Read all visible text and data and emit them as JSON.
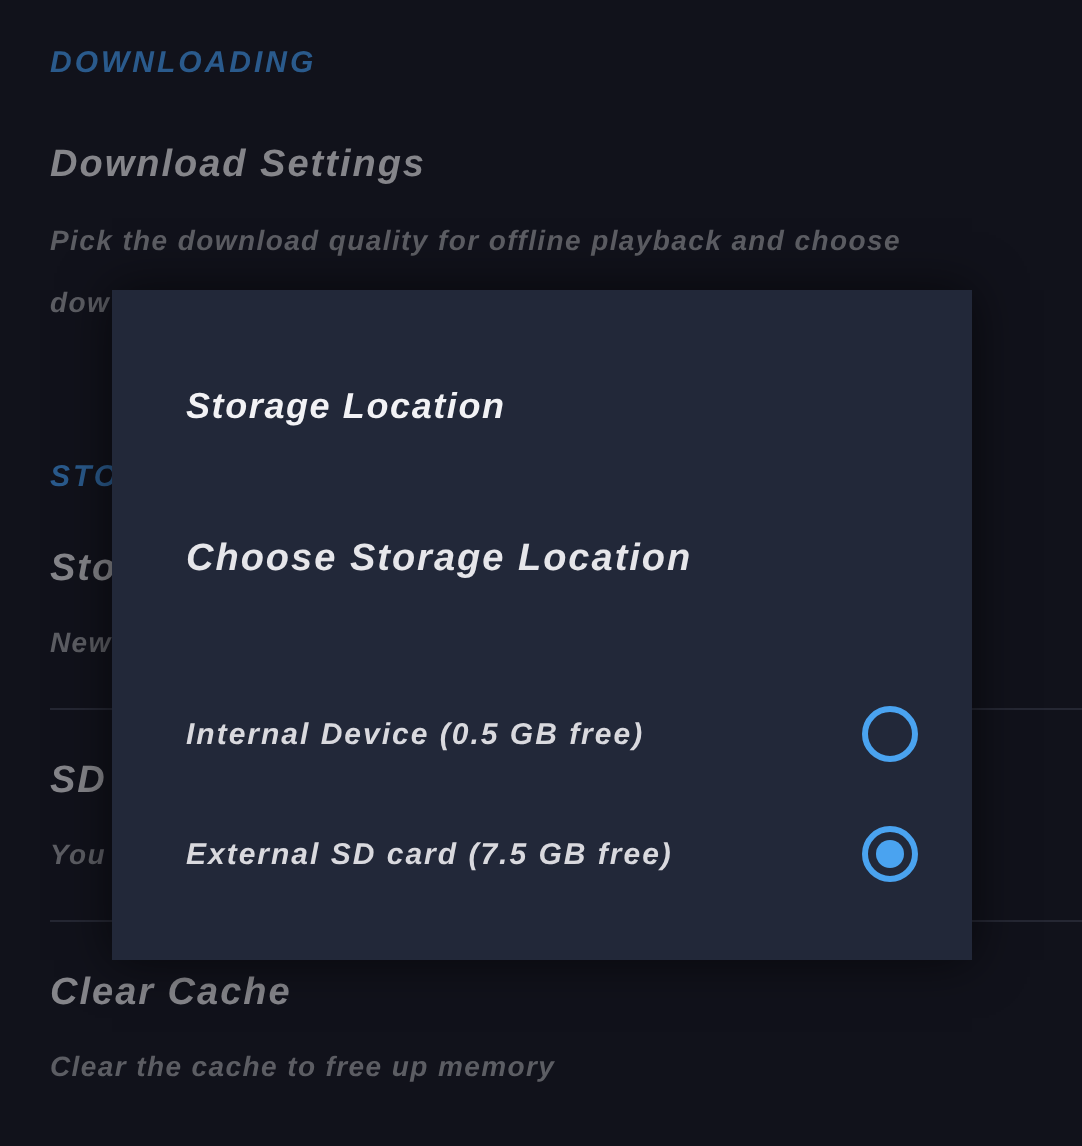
{
  "sections": [
    {
      "header": "DOWNLOADING",
      "items": [
        {
          "title": "Download Settings",
          "description": [
            "Pick the download quality for offline playback and choose",
            "dow"
          ]
        }
      ]
    },
    {
      "header": "STO",
      "items": [
        {
          "title": "Sto",
          "description": [
            "New"
          ]
        },
        {
          "title": "SD",
          "description": [
            "You"
          ]
        },
        {
          "title": "Clear Cache",
          "description": [
            "Clear the cache to free up memory"
          ]
        }
      ]
    }
  ],
  "dialog": {
    "title": "Storage Location",
    "heading": "Choose Storage Location",
    "options": [
      {
        "label": "Internal Device (0.5 GB free)",
        "selected": false
      },
      {
        "label": "External SD card (7.5 GB free)",
        "selected": true
      }
    ]
  }
}
